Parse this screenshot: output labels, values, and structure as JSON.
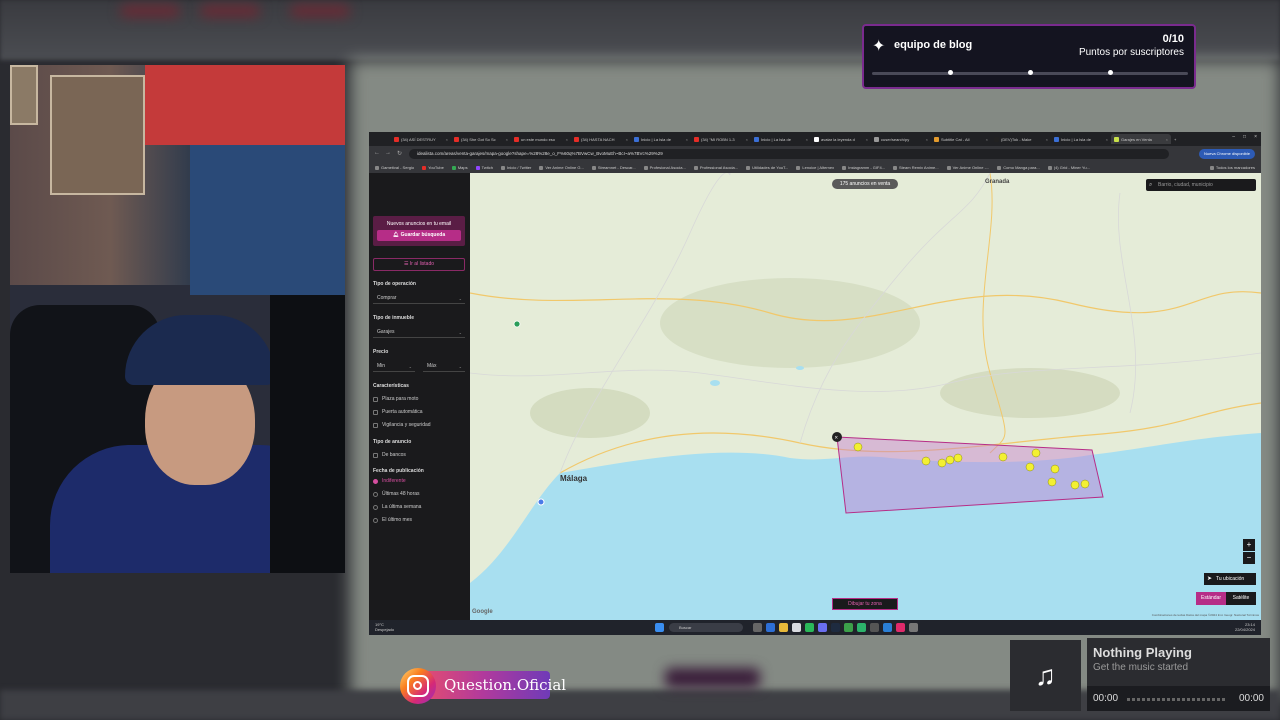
{
  "goal": {
    "title": "equipo de blog",
    "count": "0/10",
    "subtitle": "Puntos por suscriptores",
    "progress": 0
  },
  "browser": {
    "tabs": [
      "(34) ASÍ DESTRUY",
      "(34) She Got So Sc",
      "un este mundo eso",
      "(34) HASTA NACH",
      "Inicio | La Isla de",
      "(34) \"MI ROBN 1-3",
      "Inicio | La Isla de",
      "avatar la leyenda d",
      "cuser/search/py",
      "Subtitle Cat - All",
      "(DEV)Tok - Make",
      "Inicio | La Isla de",
      "Garajes en Venta"
    ],
    "url": "idealista.com/areas/venta-garajes/mapa-google?shape=%28%28e_o_F%60q%7BVwCw_BvoMuEh~BcI~a%7BVc%29%29",
    "chrome_badge": "Nueva Chrome disponible",
    "bookmarks": [
      "Gametival - Sergio",
      "YouTube",
      "Maps",
      "Twitch",
      "Inicio / Twitter",
      "Ver Anime Online G...",
      "Streamnet - Descar...",
      "Profesional Asocia...",
      "Professional Asocia...",
      "Utilidades de YouT...",
      "Lenoice | Alternex",
      "Instagramm - GIF4...",
      "Steam Remix Anime...",
      "Ver Anime Online -...",
      "Como Manga para...",
      "(4) Grid - Miner Yu...",
      "Todos los marcadores"
    ]
  },
  "panel": {
    "promo_text": "Nuevos anuncios en tu email",
    "save_button": "Guardar búsqueda",
    "list_button": "☰ Ir al listado",
    "operation_label": "Tipo de operación",
    "operation_value": "Comprar",
    "property_label": "Tipo de inmueble",
    "property_value": "Garajes",
    "price_label": "Precio",
    "price_min": "Min",
    "price_max": "Máx",
    "features_label": "Características",
    "features": [
      "Plaza para moto",
      "Puerta automática",
      "Vigilancia y seguridad"
    ],
    "ad_type_label": "Tipo de anuncio",
    "ad_types": [
      "De bancos"
    ],
    "pub_date_label": "Fecha de publicación",
    "pub_dates": [
      "Indiferente",
      "Últimas 48 horas",
      "La última semana",
      "El último mes"
    ],
    "pub_date_selected": 0
  },
  "map": {
    "ads_count": "175 anuncios en venta",
    "search_placeholder": "Barrio, ciudad, municipio",
    "city_malaga": "Málaga",
    "city_granada": "Granada",
    "my_location": "Tu ubicación",
    "map_standard": "Estándar",
    "map_satellite": "Satélite",
    "draw_button": "Dibujar tu zona",
    "google": "Google",
    "copyright": "Combinaciones de teclas  Datos del mapa ©2024 Inst. Geogr. Nacional  Términos",
    "shape_color": "#b62d87"
  },
  "taskbar": {
    "weather_temp": "19°C",
    "weather_desc": "Despejado",
    "search": "Buscar",
    "time": "23:14",
    "date": "22/04/2024"
  },
  "instagram": {
    "handle": "Question.Oficial"
  },
  "music": {
    "title": "Nothing Playing",
    "subtitle": "Get the music started",
    "time_start": "00:00",
    "time_end": "00:00"
  }
}
